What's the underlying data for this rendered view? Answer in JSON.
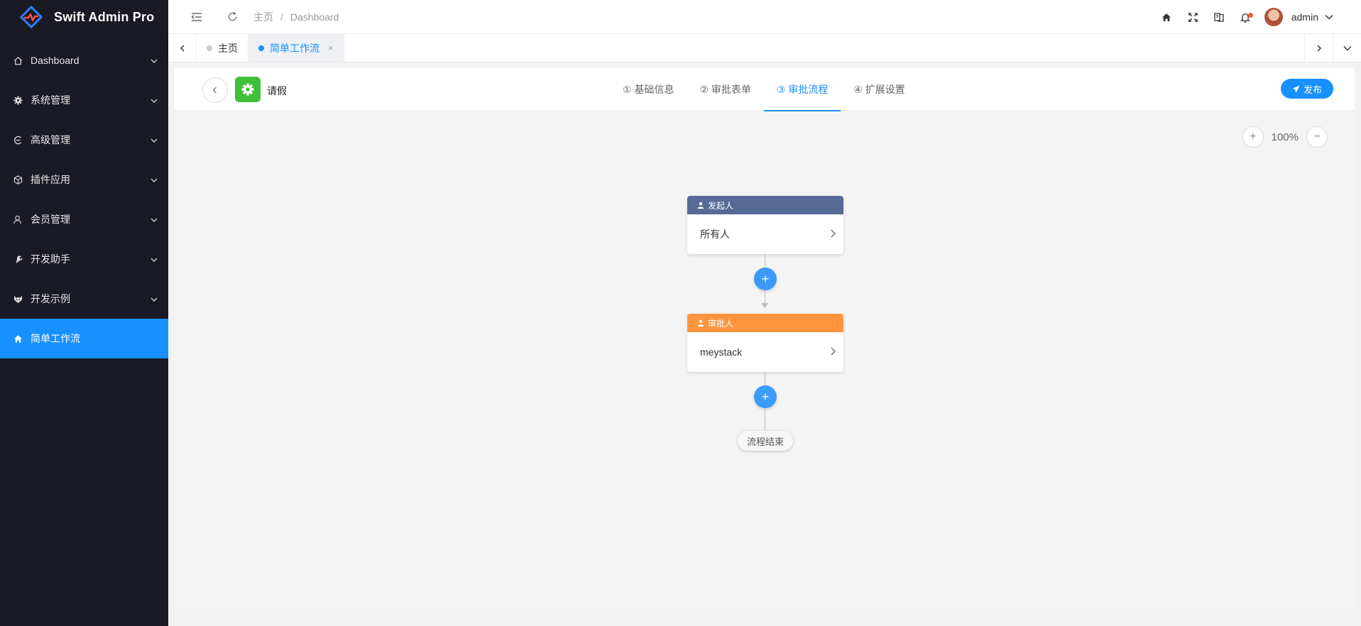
{
  "app": {
    "title": "Swift Admin Pro"
  },
  "sidebar": {
    "items": [
      {
        "label": "Dashboard",
        "icon": "home-outline-icon",
        "active": false
      },
      {
        "label": "系统管理",
        "icon": "gear-icon",
        "active": false
      },
      {
        "label": "高级管理",
        "icon": "circle-e-icon",
        "active": false
      },
      {
        "label": "插件应用",
        "icon": "cube-icon",
        "active": false
      },
      {
        "label": "会员管理",
        "icon": "user-icon",
        "active": false
      },
      {
        "label": "开发助手",
        "icon": "wrench-icon",
        "active": false
      },
      {
        "label": "开发示例",
        "icon": "fox-icon",
        "active": false
      },
      {
        "label": "简单工作流",
        "icon": "home-icon",
        "active": true
      }
    ]
  },
  "header": {
    "breadcrumb": [
      "主页",
      "Dashboard"
    ],
    "breadcrumb_sep": "/",
    "user": "admin"
  },
  "tabs": {
    "items": [
      {
        "label": "主页",
        "active": false
      },
      {
        "label": "简单工作流",
        "active": true,
        "close": "×"
      }
    ]
  },
  "toolbar": {
    "title": "请假",
    "steps": [
      {
        "label": "① 基础信息",
        "active": false
      },
      {
        "label": "② 审批表单",
        "active": false
      },
      {
        "label": "③ 审批流程",
        "active": true
      },
      {
        "label": "④ 扩展设置",
        "active": false
      }
    ],
    "publish": "发布"
  },
  "zoom": {
    "value": "100%",
    "plus": "+",
    "minus": "−"
  },
  "flow": {
    "initiator": {
      "title": "发起人",
      "content": "所有人",
      "color": "#576a95"
    },
    "approver": {
      "title": "审批人",
      "content": "meystack",
      "color": "#ff943e"
    },
    "add_symbol": "+",
    "end": "流程结束"
  },
  "colors": {
    "primary": "#1890ff",
    "sidebar_bg": "#191a23",
    "start_node": "#3fc03b"
  }
}
